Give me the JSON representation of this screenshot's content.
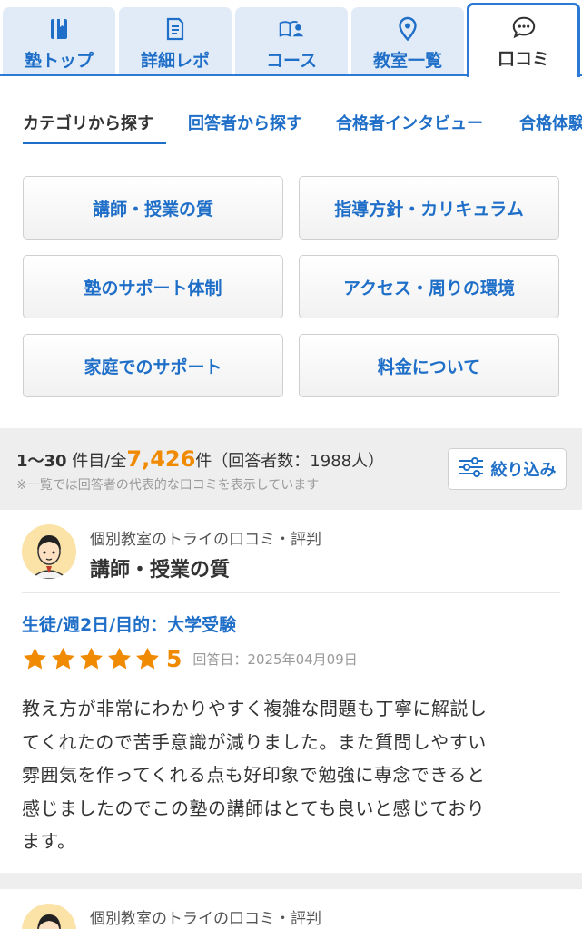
{
  "tabs": [
    {
      "label": "塾トップ",
      "icon": "book-icon"
    },
    {
      "label": "詳細レポ",
      "icon": "document-icon"
    },
    {
      "label": "コース",
      "icon": "course-icon"
    },
    {
      "label": "教室一覧",
      "icon": "location-pin-icon"
    },
    {
      "label": "口コミ",
      "icon": "chat-bubble-icon",
      "active": true
    }
  ],
  "subtabs": [
    {
      "label": "カテゴリから探す",
      "active": true
    },
    {
      "label": "回答者から探す"
    },
    {
      "label": "合格者インタビュー"
    },
    {
      "label": "合格体験"
    }
  ],
  "categories": [
    "講師・授業の質",
    "指導方針・カリキュラム",
    "塾のサポート体制",
    "アクセス・周りの環境",
    "家庭でのサポート",
    "料金について"
  ],
  "summary": {
    "range": "1〜30",
    "range_suffix": " 件目/全",
    "total": "7,426",
    "total_suffix": "件（回答者数：1988人）",
    "note": "※一覧では回答者の代表的な口コミを表示しています",
    "filter_label": "絞り込み"
  },
  "reviews": [
    {
      "school": "個別教室のトライの口コミ・評判",
      "category": "講師・授業の質",
      "meta": "生徒/週2日/目的：大学受験",
      "rating": 5,
      "rating_label": "5",
      "date": "回答日：2025年04月09日",
      "lines": [
        "教え方が非常にわかりやすく複雑な問題も丁寧に解説し",
        "てくれたので苦手意識が減りました。また質問しやすい",
        "雰囲気を作ってくれる点も好印象で勉強に専念できると",
        "感じましたのでこの塾の講師はとても良いと感じており",
        "ます。"
      ]
    },
    {
      "school": "個別教室のトライの口コミ・評判"
    }
  ],
  "colors": {
    "accent": "#1f6fc8",
    "tab_border": "#2a7ad6",
    "star": "#f08a00",
    "tab_bg": "#e1ebf7"
  }
}
